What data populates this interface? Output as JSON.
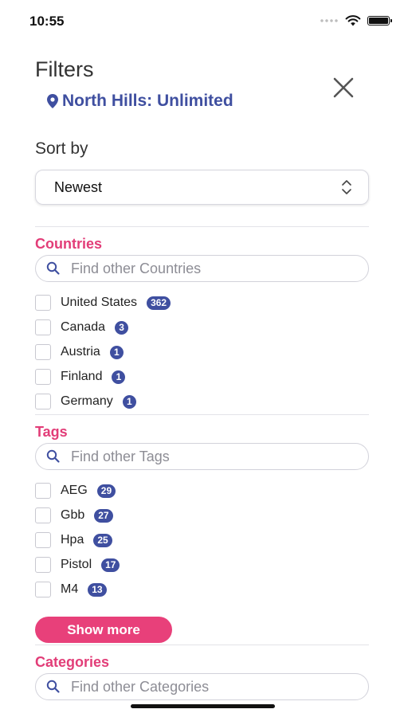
{
  "status_bar": {
    "time": "10:55"
  },
  "header": {
    "title": "Filters",
    "location": "North Hills: Unlimited"
  },
  "sort": {
    "label": "Sort by",
    "selected": "Newest"
  },
  "countries": {
    "title": "Countries",
    "search_placeholder": "Find other Countries",
    "items": [
      {
        "label": "United States",
        "count": "362"
      },
      {
        "label": "Canada",
        "count": "3"
      },
      {
        "label": "Austria",
        "count": "1"
      },
      {
        "label": "Finland",
        "count": "1"
      },
      {
        "label": "Germany",
        "count": "1"
      }
    ]
  },
  "tags": {
    "title": "Tags",
    "search_placeholder": "Find other Tags",
    "items": [
      {
        "label": "AEG",
        "count": "29"
      },
      {
        "label": "Gbb",
        "count": "27"
      },
      {
        "label": "Hpa",
        "count": "25"
      },
      {
        "label": "Pistol",
        "count": "17"
      },
      {
        "label": "M4",
        "count": "13"
      }
    ],
    "show_more": "Show more"
  },
  "categories": {
    "title": "Categories",
    "search_placeholder": "Find other Categories"
  },
  "colors": {
    "accent": "#e23d78",
    "brand": "#3f4fa0",
    "button": "#e8407a"
  },
  "icons": [
    "wifi-icon",
    "battery-icon",
    "location-pin-icon",
    "close-icon",
    "select-chevron-icon",
    "search-icon"
  ]
}
